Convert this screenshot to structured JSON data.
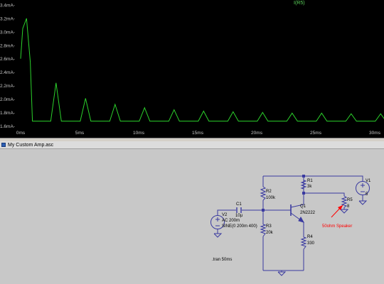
{
  "plot": {
    "trace_label": "I(R5)",
    "trace_color": "#2bd12b",
    "label_color": "#5cd65c",
    "y_ticks": [
      "3.4mA-",
      "3.2mA-",
      "3.0mA-",
      "2.8mA-",
      "2.6mA-",
      "2.4mA-",
      "2.2mA-",
      "2.0mA-",
      "1.8mA-",
      "1.6mA-"
    ],
    "x_ticks": [
      "0ms",
      "5ms",
      "10ms",
      "15ms",
      "20ms",
      "25ms",
      "30ms"
    ]
  },
  "chart_data": {
    "type": "line",
    "series": [
      {
        "name": "I(R5)"
      }
    ],
    "xlabel": "",
    "ylabel": "",
    "xlim": [
      0,
      31
    ],
    "ylim": [
      1.6,
      3.4
    ],
    "baseline": 1.67,
    "peak_period_ms": 2.5,
    "peaks": [
      {
        "x": 0.5,
        "y": 3.2
      },
      {
        "x": 3.0,
        "y": 2.24
      },
      {
        "x": 5.5,
        "y": 2.01
      },
      {
        "x": 8.0,
        "y": 1.92
      },
      {
        "x": 10.5,
        "y": 1.87
      },
      {
        "x": 13.0,
        "y": 1.84
      },
      {
        "x": 15.5,
        "y": 1.82
      },
      {
        "x": 18.0,
        "y": 1.81
      },
      {
        "x": 20.5,
        "y": 1.8
      },
      {
        "x": 23.0,
        "y": 1.79
      },
      {
        "x": 25.5,
        "y": 1.79
      },
      {
        "x": 28.0,
        "y": 1.78
      },
      {
        "x": 30.5,
        "y": 1.78
      }
    ]
  },
  "schematic_window": {
    "title": "My Custom Amp.asc"
  },
  "schematic": {
    "wire_color": "#3a3aa0",
    "annotation_color": "#ff0000",
    "R1": {
      "name": "R1",
      "value": "3k"
    },
    "R2": {
      "name": "R2",
      "value": "100k"
    },
    "R3": {
      "name": "R3",
      "value": "20k"
    },
    "R4": {
      "name": "R4",
      "value": "330"
    },
    "R5": {
      "name": "R5",
      "value": "8"
    },
    "C1": {
      "name": "C1",
      "value": "10µ"
    },
    "Q1": {
      "name": "Q1",
      "value": "2N2222"
    },
    "V1": {
      "name": "V1",
      "value": "5"
    },
    "V2": {
      "name": "V2",
      "ac": "AC 200m",
      "sine": "SINE(0 200m 400)"
    },
    "directive": ".tran 50ms",
    "annotation": "50ohm Speaker"
  }
}
